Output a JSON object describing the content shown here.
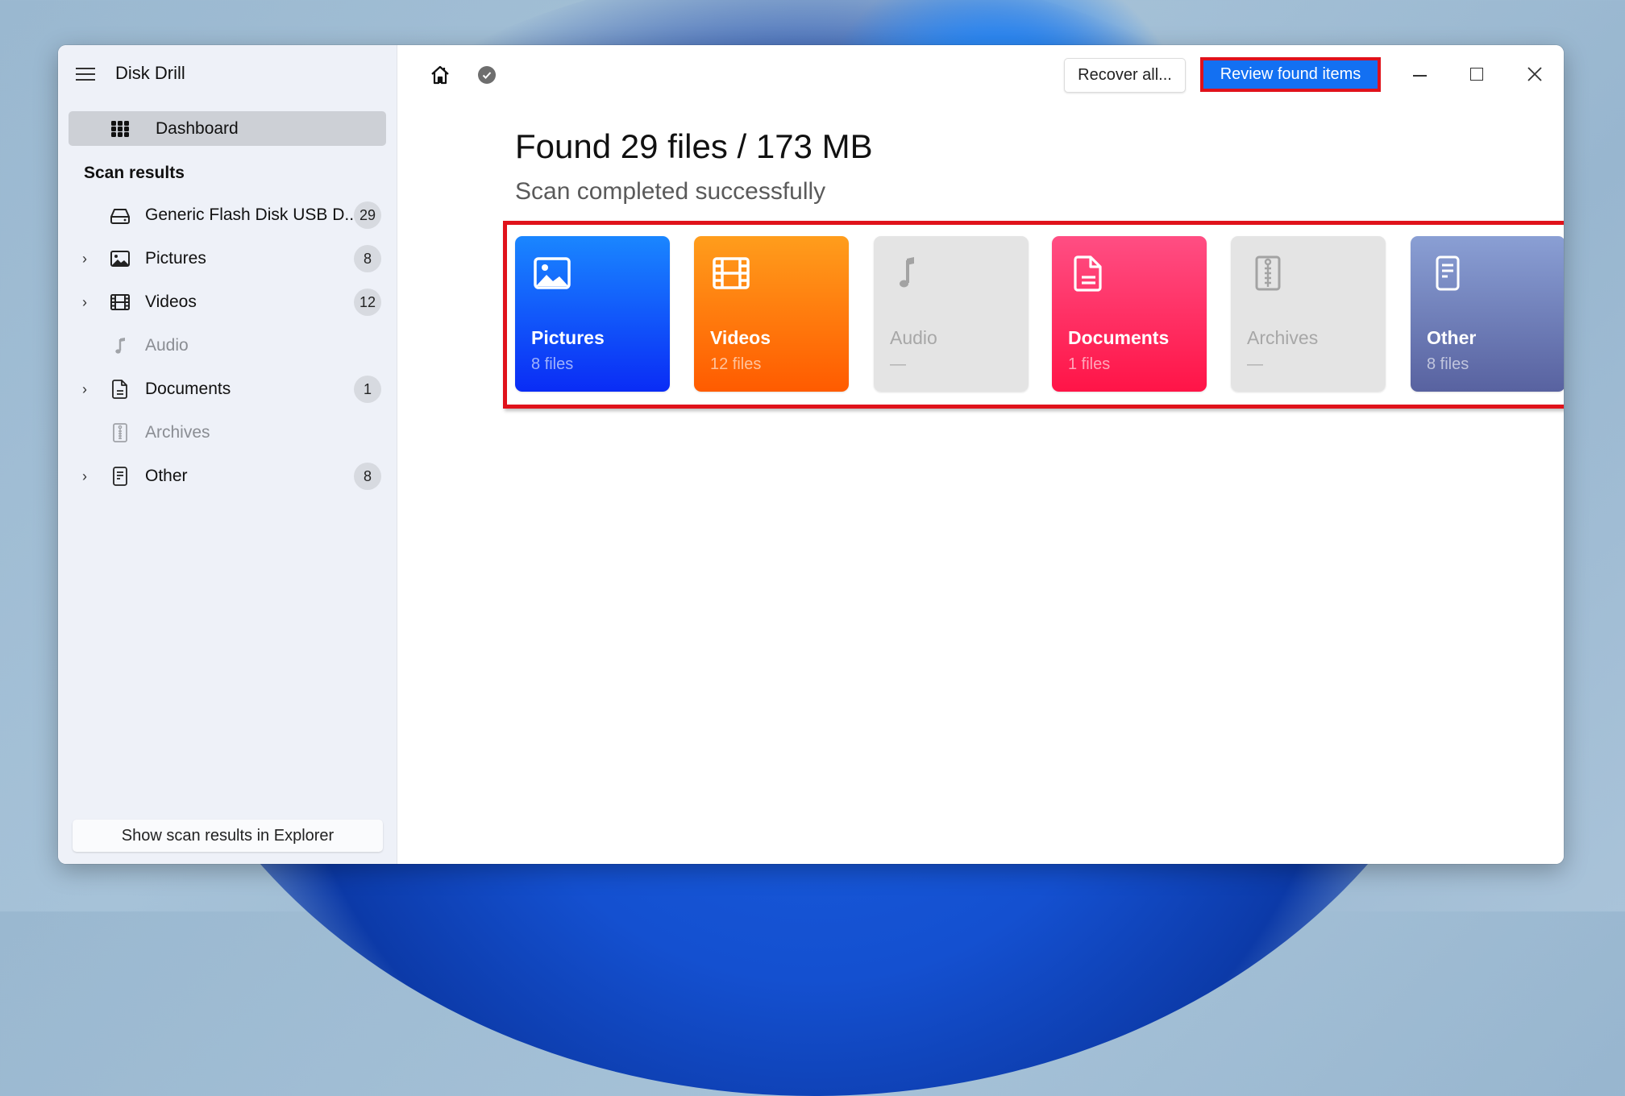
{
  "app": {
    "title": "Disk Drill"
  },
  "sidebar": {
    "dashboard_label": "Dashboard",
    "section_title": "Scan results",
    "items": [
      {
        "label": "Generic Flash Disk USB D...",
        "count": "29",
        "icon": "drive-icon",
        "expandable": false,
        "enabled": true
      },
      {
        "label": "Pictures",
        "count": "8",
        "icon": "picture-icon",
        "expandable": true,
        "enabled": true
      },
      {
        "label": "Videos",
        "count": "12",
        "icon": "film-icon",
        "expandable": true,
        "enabled": true
      },
      {
        "label": "Audio",
        "count": null,
        "icon": "music-note-icon",
        "expandable": false,
        "enabled": false
      },
      {
        "label": "Documents",
        "count": "1",
        "icon": "document-icon",
        "expandable": true,
        "enabled": true
      },
      {
        "label": "Archives",
        "count": null,
        "icon": "archive-zip-icon",
        "expandable": false,
        "enabled": false
      },
      {
        "label": "Other",
        "count": "8",
        "icon": "other-file-icon",
        "expandable": true,
        "enabled": true
      }
    ],
    "explorer_button": "Show scan results in Explorer"
  },
  "toolbar": {
    "recover_all": "Recover all...",
    "review_found": "Review found items"
  },
  "main": {
    "headline": "Found 29 files / 173 MB",
    "status": "Scan completed successfully",
    "cards": [
      {
        "title": "Pictures",
        "subtitle": "8 files",
        "enabled": true,
        "color_top": "#1a86ff",
        "color_bottom": "#0a2cf5"
      },
      {
        "title": "Videos",
        "subtitle": "12 files",
        "enabled": true,
        "color_top": "#ff9d1c",
        "color_bottom": "#ff5b00"
      },
      {
        "title": "Audio",
        "subtitle": "—",
        "enabled": false,
        "color_top": "#e4e4e4",
        "color_bottom": "#e4e4e4"
      },
      {
        "title": "Documents",
        "subtitle": "1 files",
        "enabled": true,
        "color_top": "#ff4e83",
        "color_bottom": "#ff1447"
      },
      {
        "title": "Archives",
        "subtitle": "—",
        "enabled": false,
        "color_top": "#e4e4e4",
        "color_bottom": "#e4e4e4"
      },
      {
        "title": "Other",
        "subtitle": "8 files",
        "enabled": true,
        "color_top": "#8a9fd4",
        "color_bottom": "#5862a0"
      }
    ]
  },
  "colors": {
    "highlight_frame": "#e0121b",
    "primary_button": "#1370f2"
  }
}
